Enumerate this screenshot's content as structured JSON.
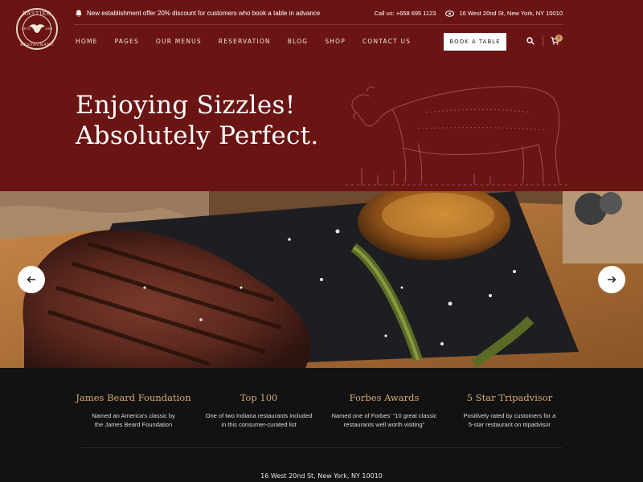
{
  "brand": {
    "name_top": "BASTIEO",
    "name_bottom": "RESTAURANT",
    "est": "ESTD",
    "year": "1998"
  },
  "topbar": {
    "announcement": "New establishment offer 20% discount for customers who book a table in advance",
    "phone": "Call us: +658 695 1123",
    "address": "16 West 20nd St, New York, NY 10010"
  },
  "nav": {
    "items": [
      "HOME",
      "PAGES",
      "OUR MENUS",
      "RESERVATION",
      "BLOG",
      "SHOP",
      "CONTACT US"
    ],
    "book_label": "BOOK A TABLE",
    "cart_count": "0"
  },
  "hero": {
    "line1": "Enjoying Sizzles!",
    "line2": "Absolutely Perfect."
  },
  "slider": {
    "prev_icon": "arrow-left-icon",
    "next_icon": "arrow-right-icon"
  },
  "awards": [
    {
      "title": "James Beard Foundation",
      "line1": "Named an America's classic by",
      "line2": "the James Beard Foundation"
    },
    {
      "title": "Top 100",
      "line1": "One of two Indiana restaurants included",
      "line2": "in this consumer-curated list"
    },
    {
      "title": "Forbes Awards",
      "line1": "Named one of Forbes' \"10 great classic",
      "line2": "restaurants well worth visiting\""
    },
    {
      "title": "5 Star Tripadvisor",
      "line1": "Positively rated by customers for a",
      "line2": "5-star restaurant on tripadvisor"
    }
  ],
  "footer": {
    "address": "16 West 20nd St, New York, NY 10010"
  },
  "colors": {
    "brand_red": "#6b1414",
    "accent_gold": "#d8a874",
    "dark_bg": "#121212"
  }
}
